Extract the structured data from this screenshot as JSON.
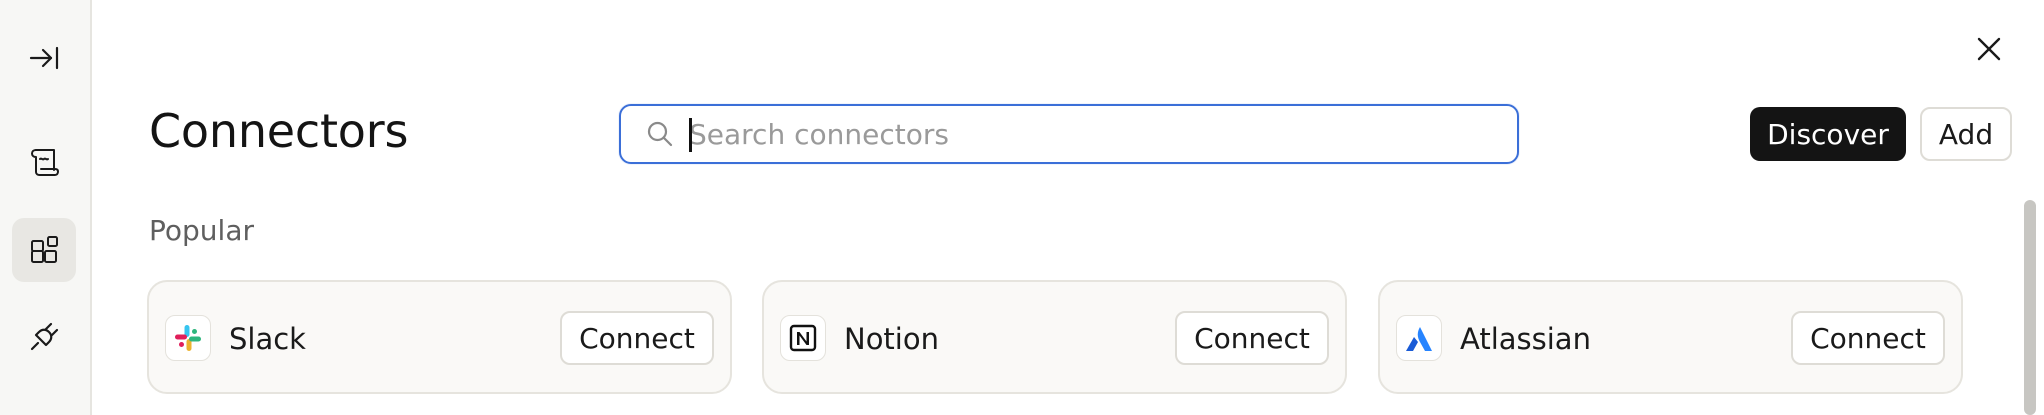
{
  "header": {
    "title": "Connectors",
    "discover_label": "Discover",
    "add_label": "Add"
  },
  "search": {
    "placeholder": "Search connectors",
    "value": ""
  },
  "sections": {
    "popular_label": "Popular"
  },
  "connectors": [
    {
      "name": "Slack",
      "icon": "slack-icon",
      "action": "Connect"
    },
    {
      "name": "Notion",
      "icon": "notion-icon",
      "action": "Connect"
    },
    {
      "name": "Atlassian",
      "icon": "atlassian-icon",
      "action": "Connect"
    }
  ],
  "rail": {
    "items": [
      {
        "icon": "expand-sidebar-icon",
        "active": false
      },
      {
        "icon": "scroll-icon",
        "active": false
      },
      {
        "icon": "connectors-grid-icon",
        "active": true
      },
      {
        "icon": "plug-icon",
        "active": false
      }
    ]
  },
  "colors": {
    "accent_focus": "#3b6fd8",
    "primary_button": "#141414",
    "rail_background": "#f7f7f5",
    "card_background": "#faf9f7"
  }
}
